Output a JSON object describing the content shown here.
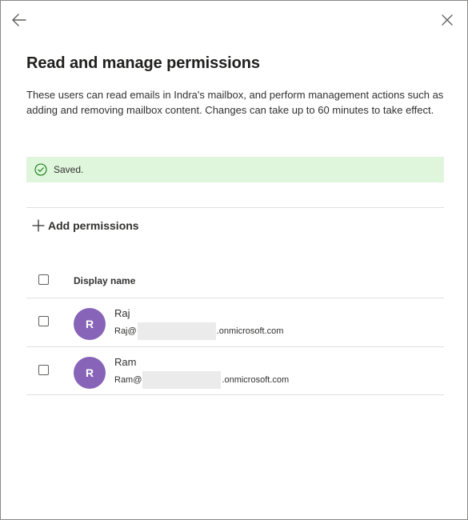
{
  "panel": {
    "title": "Read and manage permissions",
    "description": "These users can read emails in Indra's mailbox, and perform management actions such as adding and removing mailbox content. Changes can take up to 60 minutes to take effect.",
    "icons": {
      "back": "back-arrow-icon",
      "close": "close-icon"
    }
  },
  "status": {
    "text": "Saved.",
    "icon": "checkmark-circle-icon",
    "background": "#dff6dd",
    "icon_color": "#107c10"
  },
  "toolbar": {
    "add_label": "Add permissions",
    "add_icon": "plus-icon"
  },
  "table": {
    "header": {
      "display_name": "Display name"
    },
    "rows": [
      {
        "initial": "R",
        "name": "Raj",
        "email_prefix": "Raj@",
        "email_suffix": ".onmicrosoft.com",
        "avatar_color": "#8764b8"
      },
      {
        "initial": "R",
        "name": "Ram",
        "email_prefix": "Ram@",
        "email_suffix": ".onmicrosoft.com",
        "avatar_color": "#8764b8"
      }
    ]
  }
}
